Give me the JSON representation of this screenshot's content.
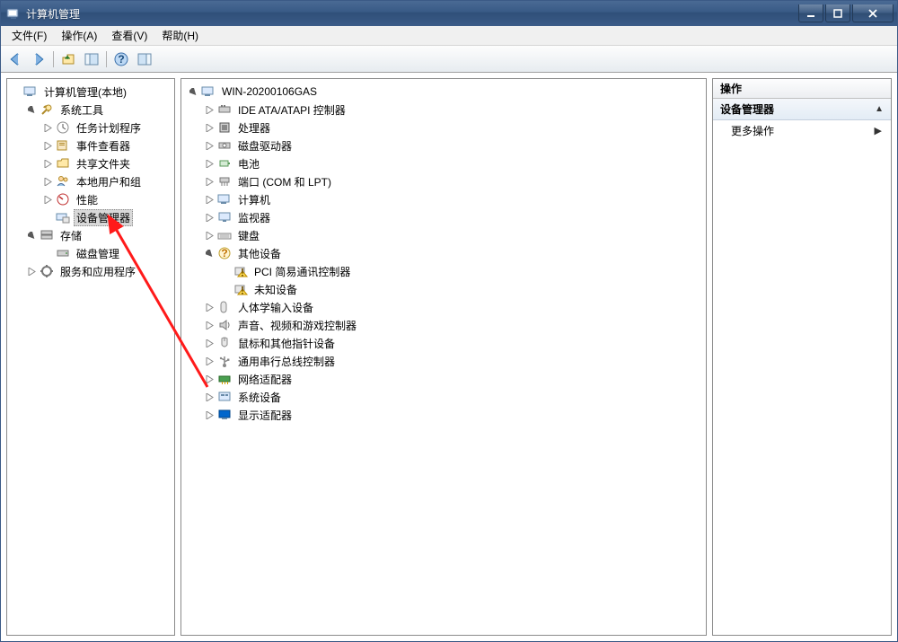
{
  "window": {
    "title": "计算机管理"
  },
  "menu": {
    "file": "文件(F)",
    "action": "操作(A)",
    "view": "查看(V)",
    "help": "帮助(H)"
  },
  "toolbar": {
    "back": "back",
    "forward": "forward",
    "up": "up",
    "show_console_tree": "show_console_tree",
    "help": "help",
    "show_action_pane": "show_action_pane"
  },
  "left_tree": {
    "root": "计算机管理(本地)",
    "system_tools": "系统工具",
    "task_scheduler": "任务计划程序",
    "event_viewer": "事件查看器",
    "shared_folders": "共享文件夹",
    "local_users": "本地用户和组",
    "performance": "性能",
    "device_manager": "设备管理器",
    "storage": "存储",
    "disk_management": "磁盘管理",
    "services_apps": "服务和应用程序"
  },
  "center_tree": {
    "root": "WIN-20200106GAS",
    "ide": "IDE ATA/ATAPI 控制器",
    "cpu": "处理器",
    "disk_drives": "磁盘驱动器",
    "battery": "电池",
    "ports": "端口 (COM 和 LPT)",
    "computer": "计算机",
    "monitor": "监视器",
    "keyboard": "键盘",
    "other": "其他设备",
    "pci": "PCI 简易通讯控制器",
    "unknown": "未知设备",
    "hid": "人体学输入设备",
    "sound": "声音、视频和游戏控制器",
    "mouse": "鼠标和其他指针设备",
    "usb": "通用串行总线控制器",
    "network": "网络适配器",
    "system_devices": "系统设备",
    "display": "显示适配器"
  },
  "right_panel": {
    "header": "操作",
    "section": "设备管理器",
    "more_actions": "更多操作"
  }
}
